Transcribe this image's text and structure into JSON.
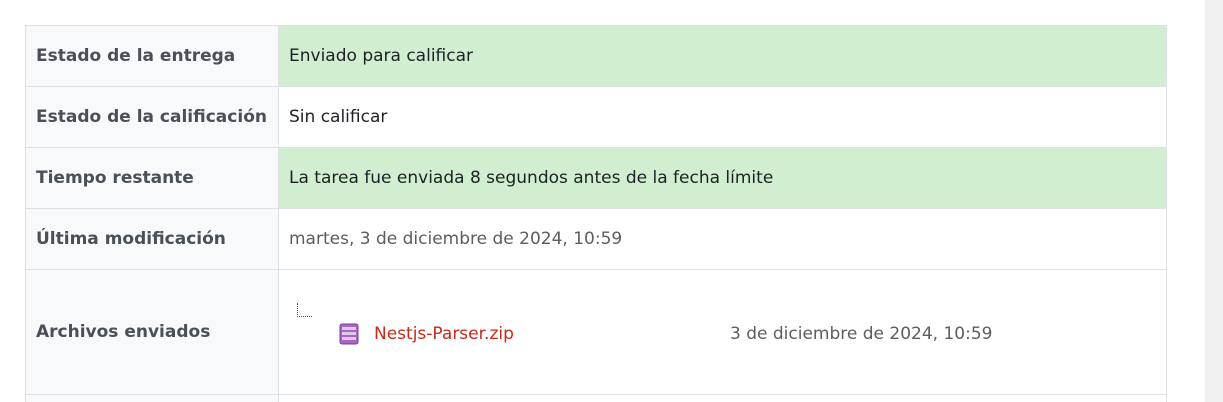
{
  "submission_status": {
    "rows": [
      {
        "label": "Estado de la entrega",
        "value": "Enviado para calificar"
      },
      {
        "label": "Estado de la calificación",
        "value": "Sin calificar"
      },
      {
        "label": "Tiempo restante",
        "value": "La tarea fue enviada 8 segundos antes de la fecha límite"
      },
      {
        "label": "Última modificación",
        "value": "martes, 3 de diciembre de 2024, 10:59"
      },
      {
        "label": "Archivos enviados"
      }
    ],
    "files": [
      {
        "name": "Nestjs-Parser.zip",
        "date": "3 de diciembre de 2024, 10:59",
        "icon": "archive-icon"
      }
    ]
  },
  "colors": {
    "success_bg": "#d1eed0",
    "link": "#c72a17",
    "header_bg": "#f8f9fa",
    "border": "#dee2e6"
  }
}
